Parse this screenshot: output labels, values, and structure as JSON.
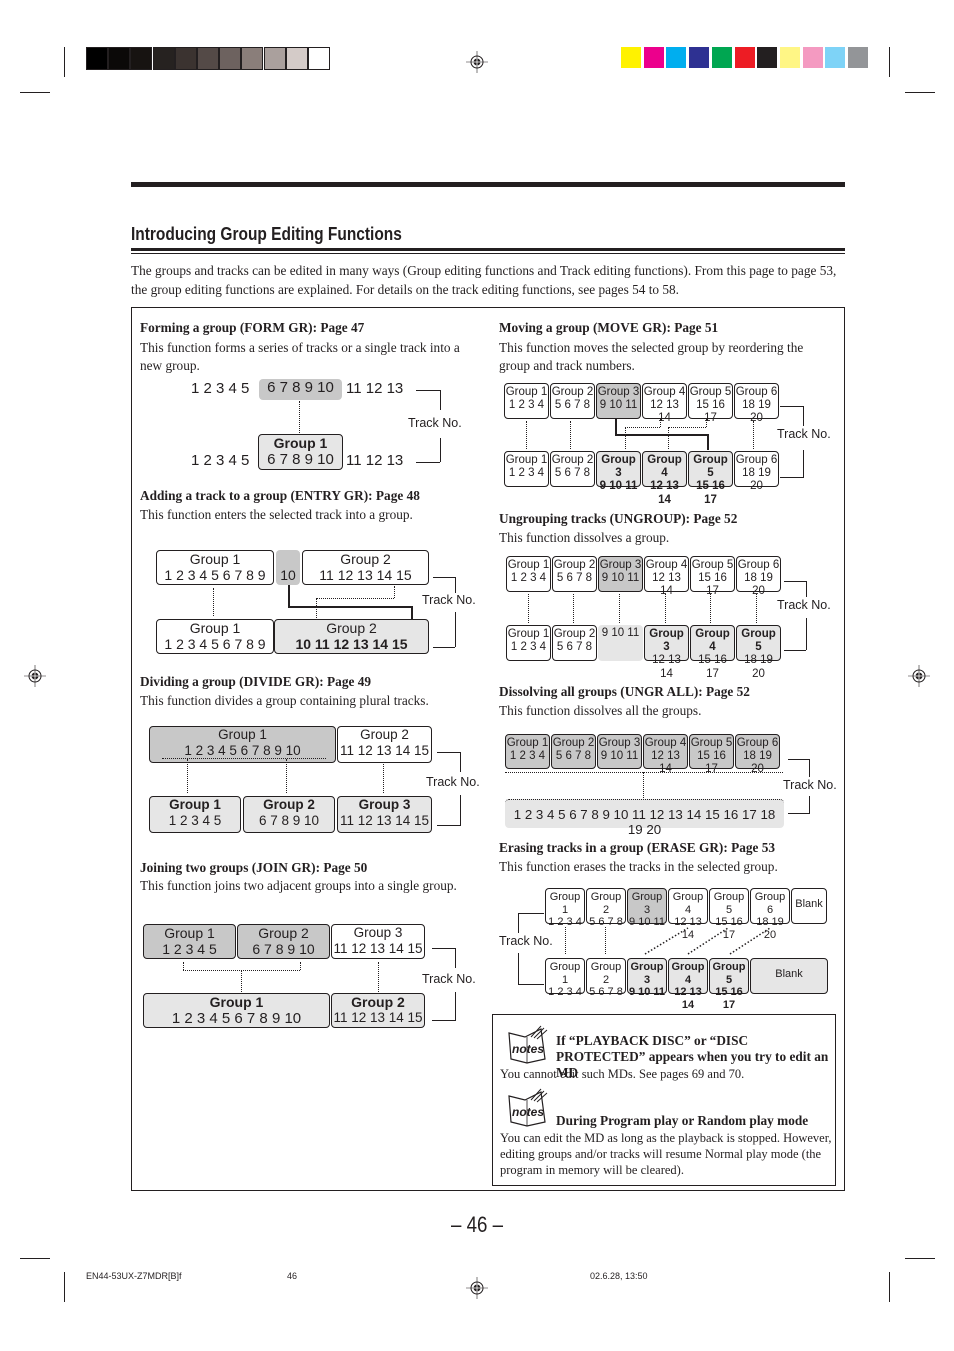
{
  "print_marks": {
    "gray_swatches": [
      "#000000",
      "#0b0908",
      "#171311",
      "#262220",
      "#3b3330",
      "#544a47",
      "#6d625f",
      "#8a7e7a",
      "#aaa09d",
      "#d4cbc8",
      "#ffffff"
    ],
    "color_swatches": [
      "#fff200",
      "#ec008c",
      "#00aeef",
      "#2e3192",
      "#00a651",
      "#ed1c24",
      "#231f20",
      "#fff685",
      "#f49ac1",
      "#7ed3f7",
      "#939598"
    ]
  },
  "section": {
    "title": "Introducing Group Editing Functions",
    "intro": "The groups and tracks can be edited in many ways (Group editing functions and Track editing functions). From this page to page 53, the group editing functions are explained. For details on the track editing functions, see pages 54 to 58."
  },
  "track_label": "Track No.",
  "functions": {
    "form": {
      "heading": "Forming a group (FORM GR): Page 47",
      "desc": "This function forms a series of tracks or a single track into a new group.",
      "before": {
        "pre": "1 2 3 4 5",
        "sel": "6 7 8 9 10",
        "post": "11  12 13"
      },
      "after": {
        "pre": "1 2 3 4 5",
        "group": "Group 1",
        "sel": "6 7 8 9 10",
        "post": "11  12 13"
      }
    },
    "entry": {
      "heading": "Adding a track to a group (ENTRY GR): Page 48",
      "desc": "This function enters the selected track into a group.",
      "before": [
        {
          "label": "Group 1",
          "tracks": "1 2 3 4 5 6 7 8 9"
        },
        {
          "label": "",
          "tracks": "10"
        },
        {
          "label": "Group 2",
          "tracks": "11  12  13  14  15"
        }
      ],
      "after": [
        {
          "label": "Group 1",
          "tracks": "1 2 3 4 5 6 7 8 9"
        },
        {
          "label": "Group 2",
          "tracks": "10  11  12  13  14  15"
        }
      ]
    },
    "divide": {
      "heading": "Dividing a group (DIVIDE GR): Page 49",
      "desc": "This function divides a group containing plural tracks.",
      "before": [
        {
          "label": "Group 1",
          "tracks": "1  2  3  4  5  6  7  8  9  10"
        },
        {
          "label": "Group 2",
          "tracks": "11 12 13 14 15"
        }
      ],
      "after": [
        {
          "label": "Group 1",
          "tracks": "1  2  3  4  5"
        },
        {
          "label": "Group 2",
          "tracks": "6  7  8  9  10"
        },
        {
          "label": "Group 3",
          "tracks": "11 12 13 14 15"
        }
      ]
    },
    "join": {
      "heading": "Joining two groups (JOIN GR): Page 50",
      "desc": "This function joins two adjacent groups into a single group.",
      "before": [
        {
          "label": "Group 1",
          "tracks": "1 2 3 4 5"
        },
        {
          "label": "Group 2",
          "tracks": "6 7 8 9 10"
        },
        {
          "label": "Group 3",
          "tracks": "11 12 13 14 15"
        }
      ],
      "after": [
        {
          "label": "Group 1",
          "tracks": "1 2 3 4 5 6 7 8 9 10"
        },
        {
          "label": "Group 2",
          "tracks": "11 12 13 14 15"
        }
      ]
    },
    "move": {
      "heading": "Moving a group (MOVE GR): Page 51",
      "desc": "This function moves the selected group by reordering the group and track numbers.",
      "before": [
        {
          "label": "Group 1",
          "tracks": "1 2 3 4"
        },
        {
          "label": "Group 2",
          "tracks": "5 6 7 8"
        },
        {
          "label": "Group 3",
          "tracks": "9 10 11"
        },
        {
          "label": "Group 4",
          "tracks": "12 13 14"
        },
        {
          "label": "Group 5",
          "tracks": "15 16 17"
        },
        {
          "label": "Group 6",
          "tracks": "18 19 20"
        }
      ],
      "after": [
        {
          "label": "Group 1",
          "tracks": "1 2 3 4"
        },
        {
          "label": "Group 2",
          "tracks": "5 6 7 8"
        },
        {
          "label": "Group 3",
          "tracks": "9 10 11"
        },
        {
          "label": "Group 4",
          "tracks": "12 13 14"
        },
        {
          "label": "Group 5",
          "tracks": "15 16 17"
        },
        {
          "label": "Group 6",
          "tracks": "18 19 20"
        }
      ]
    },
    "ungroup": {
      "heading": "Ungrouping tracks (UNGROUP): Page 52",
      "desc": "This function dissolves a group.",
      "before": [
        {
          "label": "Group 1",
          "tracks": "1 2 3 4"
        },
        {
          "label": "Group 2",
          "tracks": "5 6 7 8"
        },
        {
          "label": "Group 3",
          "tracks": "9 10 11"
        },
        {
          "label": "Group 4",
          "tracks": "12 13 14"
        },
        {
          "label": "Group 5",
          "tracks": "15 16 17"
        },
        {
          "label": "Group 6",
          "tracks": "18 19 20"
        }
      ],
      "after": [
        {
          "label": "Group 1",
          "tracks": "1 2 3 4"
        },
        {
          "label": "Group 2",
          "tracks": "5 6 7 8"
        },
        {
          "label": "",
          "tracks": "9 10 11"
        },
        {
          "label": "Group 3",
          "tracks": "12 13 14"
        },
        {
          "label": "Group 4",
          "tracks": "15 16 17"
        },
        {
          "label": "Group 5",
          "tracks": "18 19 20"
        }
      ]
    },
    "ungr_all": {
      "heading": "Dissolving all groups (UNGR ALL): Page 52",
      "desc": "This function dissolves all the groups.",
      "before": [
        {
          "label": "Group 1",
          "tracks": "1 2 3 4"
        },
        {
          "label": "Group 2",
          "tracks": "5 6 7 8"
        },
        {
          "label": "Group 3",
          "tracks": "9 10 11"
        },
        {
          "label": "Group 4",
          "tracks": "12 13 14"
        },
        {
          "label": "Group 5",
          "tracks": "15 16 17"
        },
        {
          "label": "Group 6",
          "tracks": "18 19 20"
        }
      ],
      "after": "1 2 3 4 5 6 7 8 9 10 11 12 13 14 15 16 17 18 19 20"
    },
    "erase": {
      "heading": "Erasing tracks in a group (ERASE GR): Page 53",
      "desc": "This function erases the tracks in the selected group.",
      "before": [
        {
          "label": "Group 1",
          "tracks": "1 2 3 4"
        },
        {
          "label": "Group 2",
          "tracks": "5 6 7 8"
        },
        {
          "label": "Group 3",
          "tracks": "9 10 11"
        },
        {
          "label": "Group 4",
          "tracks": "12 13 14"
        },
        {
          "label": "Group 5",
          "tracks": "15 16 17"
        },
        {
          "label": "Group 6",
          "tracks": "18 19 20"
        },
        {
          "label": "Blank",
          "tracks": ""
        }
      ],
      "after": [
        {
          "label": "Group 1",
          "tracks": "1 2 3 4"
        },
        {
          "label": "Group 2",
          "tracks": "5 6 7 8"
        },
        {
          "label": "Group 3",
          "tracks": "9 10 11"
        },
        {
          "label": "Group 4",
          "tracks": "12 13 14"
        },
        {
          "label": "Group 5",
          "tracks": "15 16 17"
        },
        {
          "label": "Blank",
          "tracks": ""
        }
      ]
    }
  },
  "notes": {
    "icon_label": "notes",
    "note1": {
      "heading": "If “PLAYBACK DISC” or “DISC PROTECTED” appears when you try to edit an MD",
      "body": "You cannot edit such MDs. See pages 69 and 70."
    },
    "note2": {
      "heading": "During Program play or Random play mode",
      "body": "You can edit the MD as long as the playback is stopped. However, editing groups and/or tracks will resume Normal play mode (the program in memory will be cleared)."
    }
  },
  "page_number": "– 46 –",
  "footer": {
    "file": "EN44-53UX-Z7MDR[B]f",
    "page": "46",
    "date": "02.6.28, 13:50"
  }
}
